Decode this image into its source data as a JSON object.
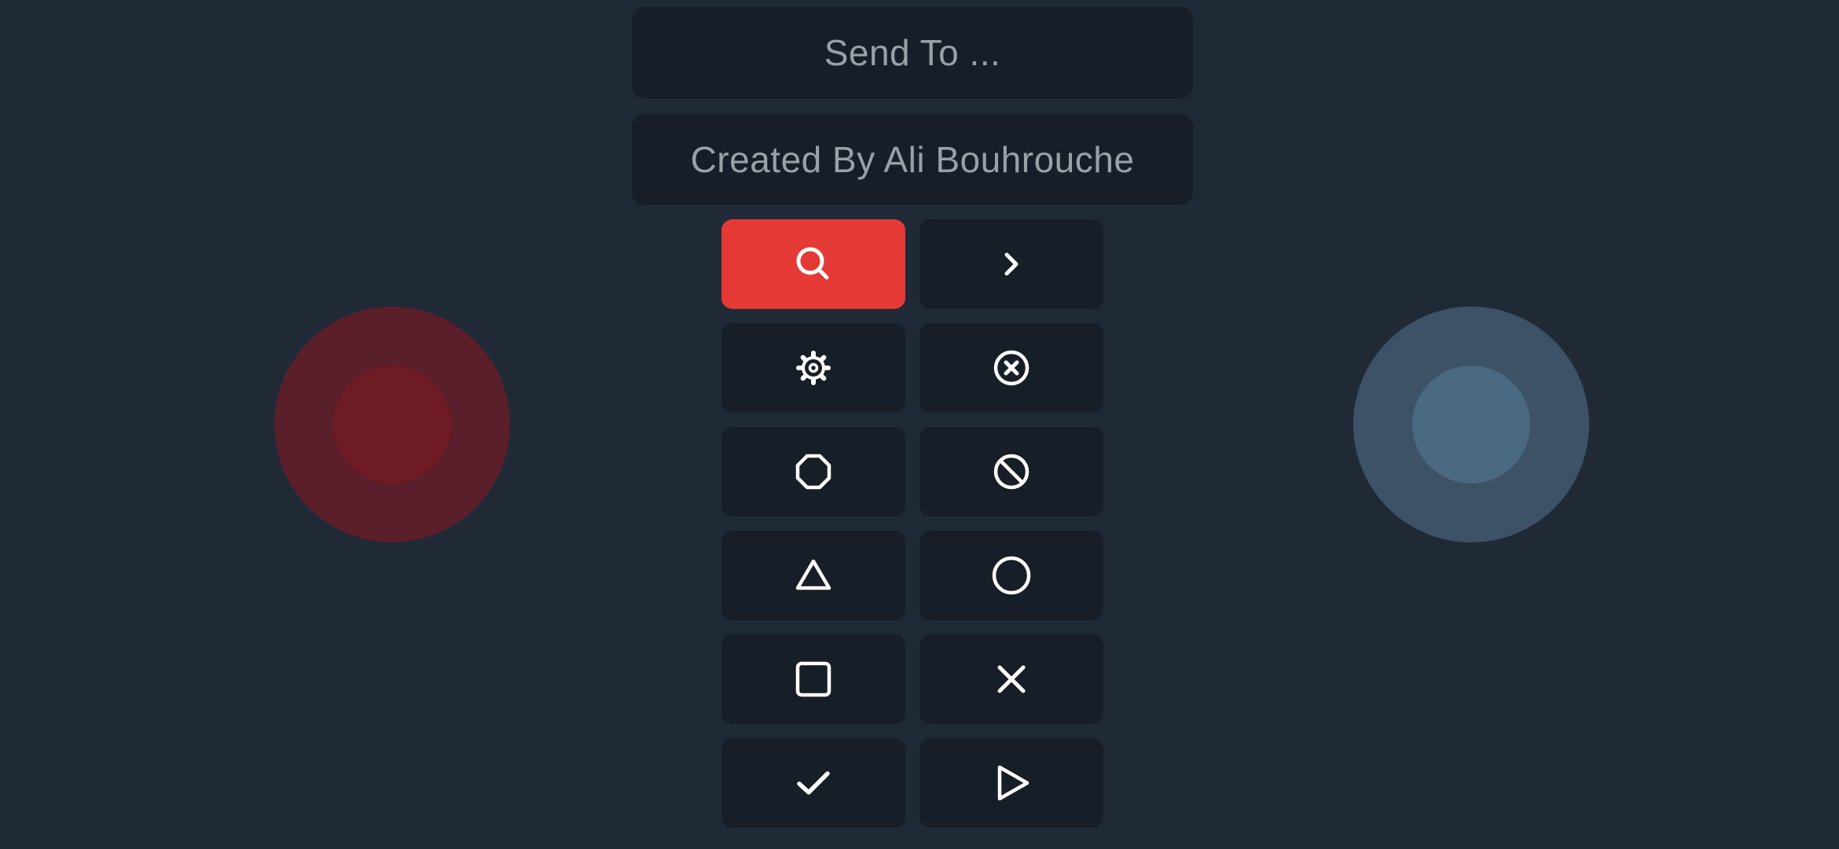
{
  "header": {
    "send_to_label": "Send To ...",
    "credit_label": "Created By Ali Bouhrouche"
  },
  "buttons": [
    {
      "icon": "search-icon",
      "active": true
    },
    {
      "icon": "chevron-right-icon",
      "active": false
    },
    {
      "icon": "gear-icon",
      "active": false
    },
    {
      "icon": "close-circle-icon",
      "active": false
    },
    {
      "icon": "octagon-icon",
      "active": false
    },
    {
      "icon": "block-icon",
      "active": false
    },
    {
      "icon": "triangle-icon",
      "active": false
    },
    {
      "icon": "circle-icon",
      "active": false
    },
    {
      "icon": "square-icon",
      "active": false
    },
    {
      "icon": "x-icon",
      "active": false
    },
    {
      "icon": "check-icon",
      "active": false
    },
    {
      "icon": "play-icon",
      "active": false
    }
  ],
  "colors": {
    "background": "#1f2a36",
    "panel": "#171e27",
    "accent": "#e53935",
    "left_joystick": "#5a1f2a",
    "right_joystick": "#3d5266",
    "text": "#9aa0a6"
  }
}
